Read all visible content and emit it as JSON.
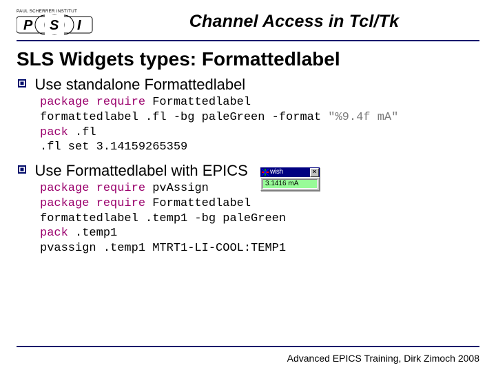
{
  "logo": {
    "top_text": "PAUL SCHERRER INSTITUT",
    "letters": "PSI"
  },
  "header": {
    "title": "Channel Access in Tcl/Tk"
  },
  "heading": "SLS Widgets types: Formattedlabel",
  "section1": {
    "bullet": "Use standalone Formattedlabel",
    "code": {
      "l1a": "package require",
      "l1b": " Formattedlabel",
      "l2a": "formattedlabel .fl -bg paleGreen -format ",
      "l2b": "\"%9.4f mA\"",
      "l3a": "pack",
      "l3b": " .fl",
      "l4": ".fl set 3.14159265359"
    }
  },
  "section2": {
    "bullet": "Use Formattedlabel with EPICS",
    "code": {
      "l1a": "package require",
      "l1b": " pvAssign",
      "l2a": "package require",
      "l2b": " Formattedlabel",
      "l3": "formattedlabel .temp1 -bg paleGreen",
      "l4a": "pack",
      "l4b": " .temp1",
      "l5": "pvassign .temp1 MTRT1-LI-COOL:TEMP1"
    }
  },
  "wish": {
    "title": "wish",
    "close": "×",
    "value": "3.1416 mA"
  },
  "footer": "Advanced EPICS Training, Dirk Zimoch 2008"
}
